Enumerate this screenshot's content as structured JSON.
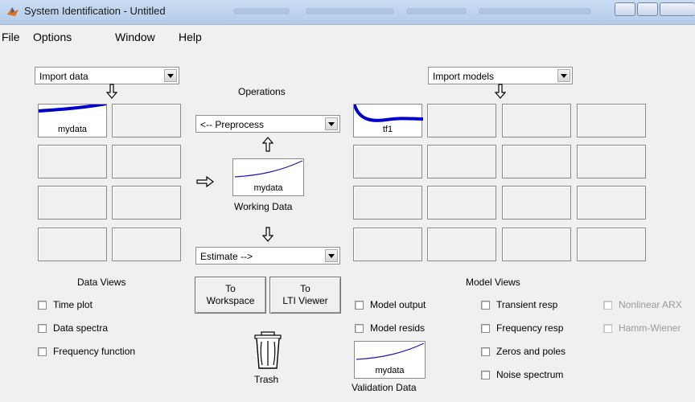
{
  "window": {
    "title": "System Identification - Untitled"
  },
  "menu": [
    "File",
    "Options",
    "Window",
    "Help"
  ],
  "data_panel": {
    "import_dropdown": "Import data",
    "tiles": [
      {
        "label": "mydata",
        "filled": true
      }
    ],
    "views_title": "Data Views",
    "checkboxes": [
      "Time plot",
      "Data spectra",
      "Frequency function"
    ]
  },
  "operations": {
    "title": "Operations",
    "preprocess_dropdown": "<-- Preprocess",
    "working_data": {
      "tile_label": "mydata",
      "caption": "Working Data"
    },
    "estimate_dropdown": "Estimate -->",
    "to_workspace": "To\nWorkspace",
    "to_lti": "To\nLTI Viewer",
    "trash": "Trash",
    "validation": {
      "tile_label": "mydata",
      "caption": "Validation Data"
    }
  },
  "model_panel": {
    "import_dropdown": "Import models",
    "tiles": [
      {
        "label": "tf1",
        "filled": true
      }
    ],
    "views_title": "Model Views",
    "checkboxes_col1": [
      "Model output",
      "Model resids"
    ],
    "checkboxes_col2": [
      "Transient resp",
      "Frequency resp",
      "Zeros and poles",
      "Noise spectrum"
    ],
    "checkboxes_col3": [
      "Nonlinear ARX",
      "Hamm-Wiener"
    ]
  },
  "colors": {
    "curve_data": "#0000cc",
    "curve_thin": "#1a1ab3",
    "titlebar": "#c1d5ee"
  },
  "icons": [
    "matlab-icon",
    "down-arrow-icon",
    "up-arrow-icon",
    "right-arrow-icon",
    "trash-icon"
  ]
}
